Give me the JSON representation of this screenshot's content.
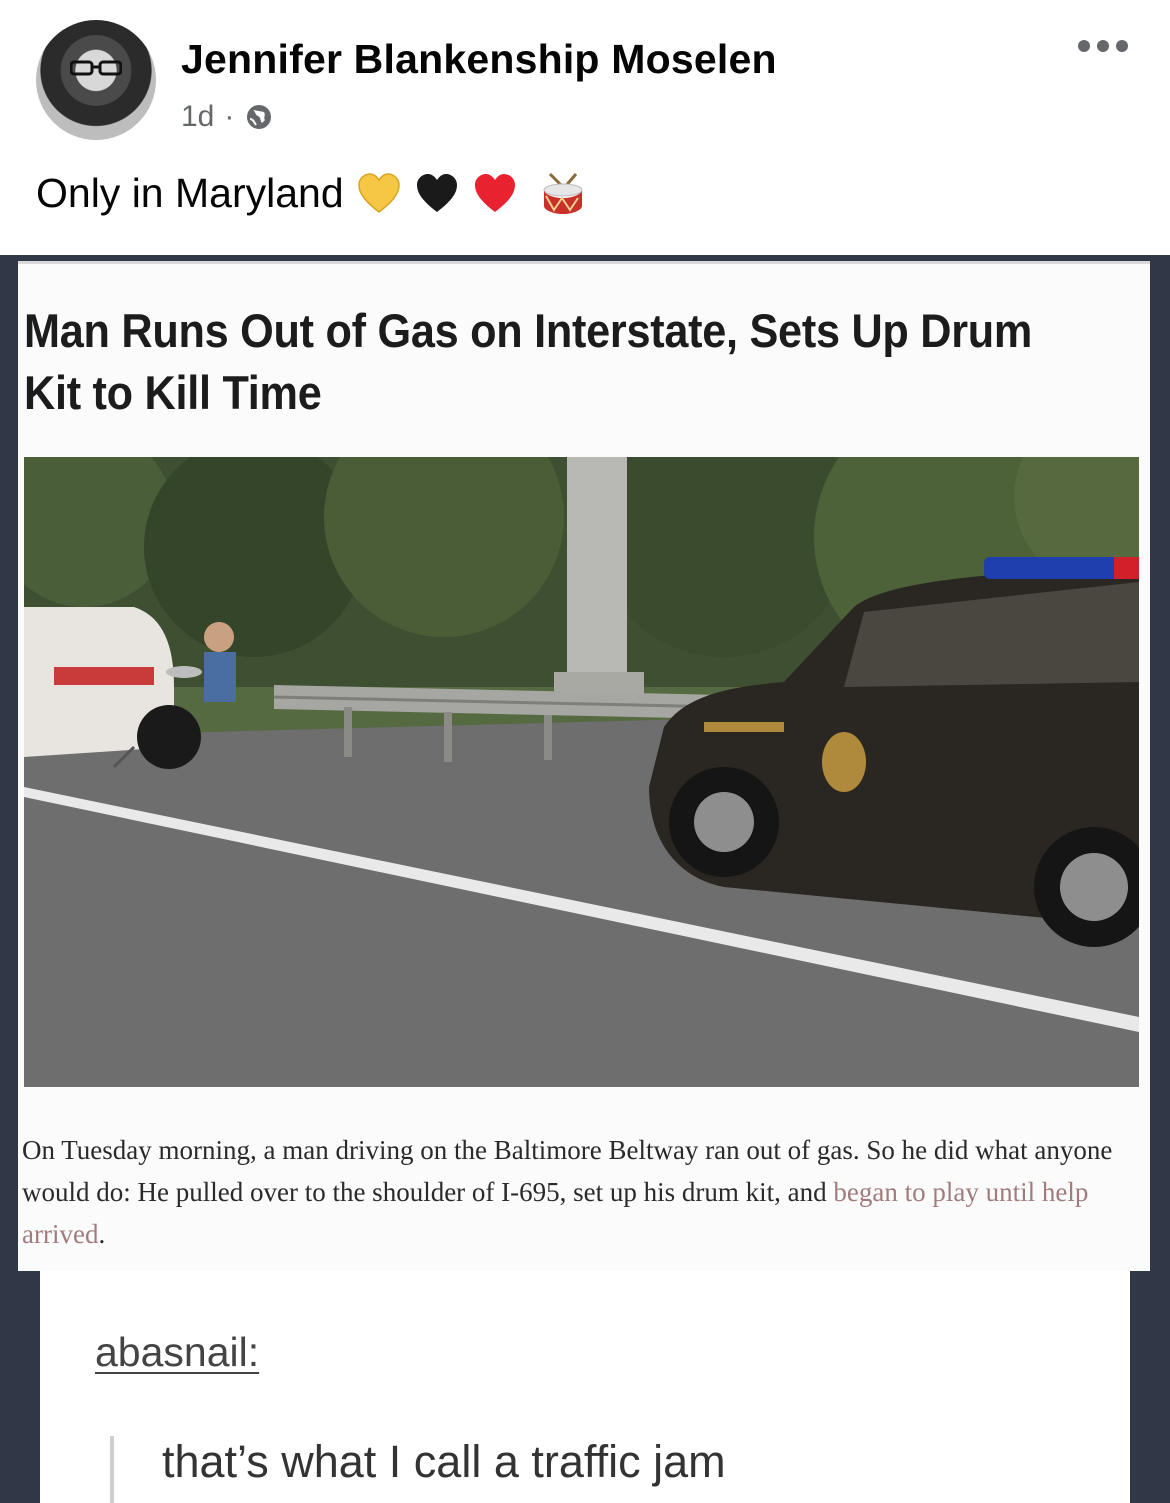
{
  "post": {
    "author": "Jennifer Blankenship Moselen",
    "time": "1d",
    "separator": "·",
    "text": "Only in Maryland",
    "emojis": [
      "yellow-heart-icon",
      "black-heart-icon",
      "red-heart-icon",
      "drum-icon"
    ]
  },
  "article": {
    "headline": "Man Runs Out of Gas on Interstate, Sets Up Drum Kit to Kill Time",
    "caption_main": "On Tuesday morning, a man driving on the Baltimore Beltway ran out of gas. So he did what anyone would do: He pulled over to the shoulder of I-695, set up his drum kit, and ",
    "caption_link": "began to play until help arrived",
    "caption_end": "."
  },
  "tumblr": {
    "username": "abasnail:",
    "reply": "that’s what I call a traffic jam"
  }
}
